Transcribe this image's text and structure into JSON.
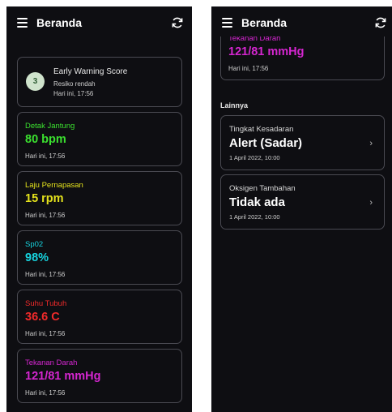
{
  "left": {
    "title": "Beranda",
    "ews": {
      "score": "3",
      "title": "Early Warning Score",
      "risk": "Resiko rendah",
      "time": "Hari ini, 17:56"
    },
    "vitals": [
      {
        "label": "Detak Jantung",
        "value": "80 bpm",
        "time": "Hari ini, 17:56",
        "color": "#3be02f"
      },
      {
        "label": "Laju Pernapasan",
        "value": "15 rpm",
        "time": "Hari ini, 17:56",
        "color": "#e4e21c"
      },
      {
        "label": "Sp02",
        "value": "98%",
        "time": "Hari ini, 17:56",
        "color": "#17d3de"
      },
      {
        "label": "Suhu Tubuh",
        "value": "36.6 C",
        "time": "Hari ini, 17:56",
        "color": "#f02a2a"
      },
      {
        "label": "Tekanan Darah",
        "value": "121/81 mmHg",
        "time": "Hari ini, 17:56",
        "color": "#d526d0"
      }
    ]
  },
  "right": {
    "title": "Beranda",
    "partial_vital": {
      "label": "Tekanan Darah",
      "value": "121/81 mmHg",
      "time": "Hari ini, 17:56",
      "color": "#d526d0"
    },
    "section_title": "Lainnya",
    "items": [
      {
        "label": "Tingkat Kesadaran",
        "value": "Alert (Sadar)",
        "date": "1 April 2022, 10:00"
      },
      {
        "label": "Oksigen Tambahan",
        "value": "Tidak ada",
        "date": "1 April 2022, 10:00"
      }
    ]
  },
  "icons": {
    "menu": "hamburger-menu-icon",
    "refresh": "refresh-icon",
    "chevron": "chevron-right-icon"
  }
}
